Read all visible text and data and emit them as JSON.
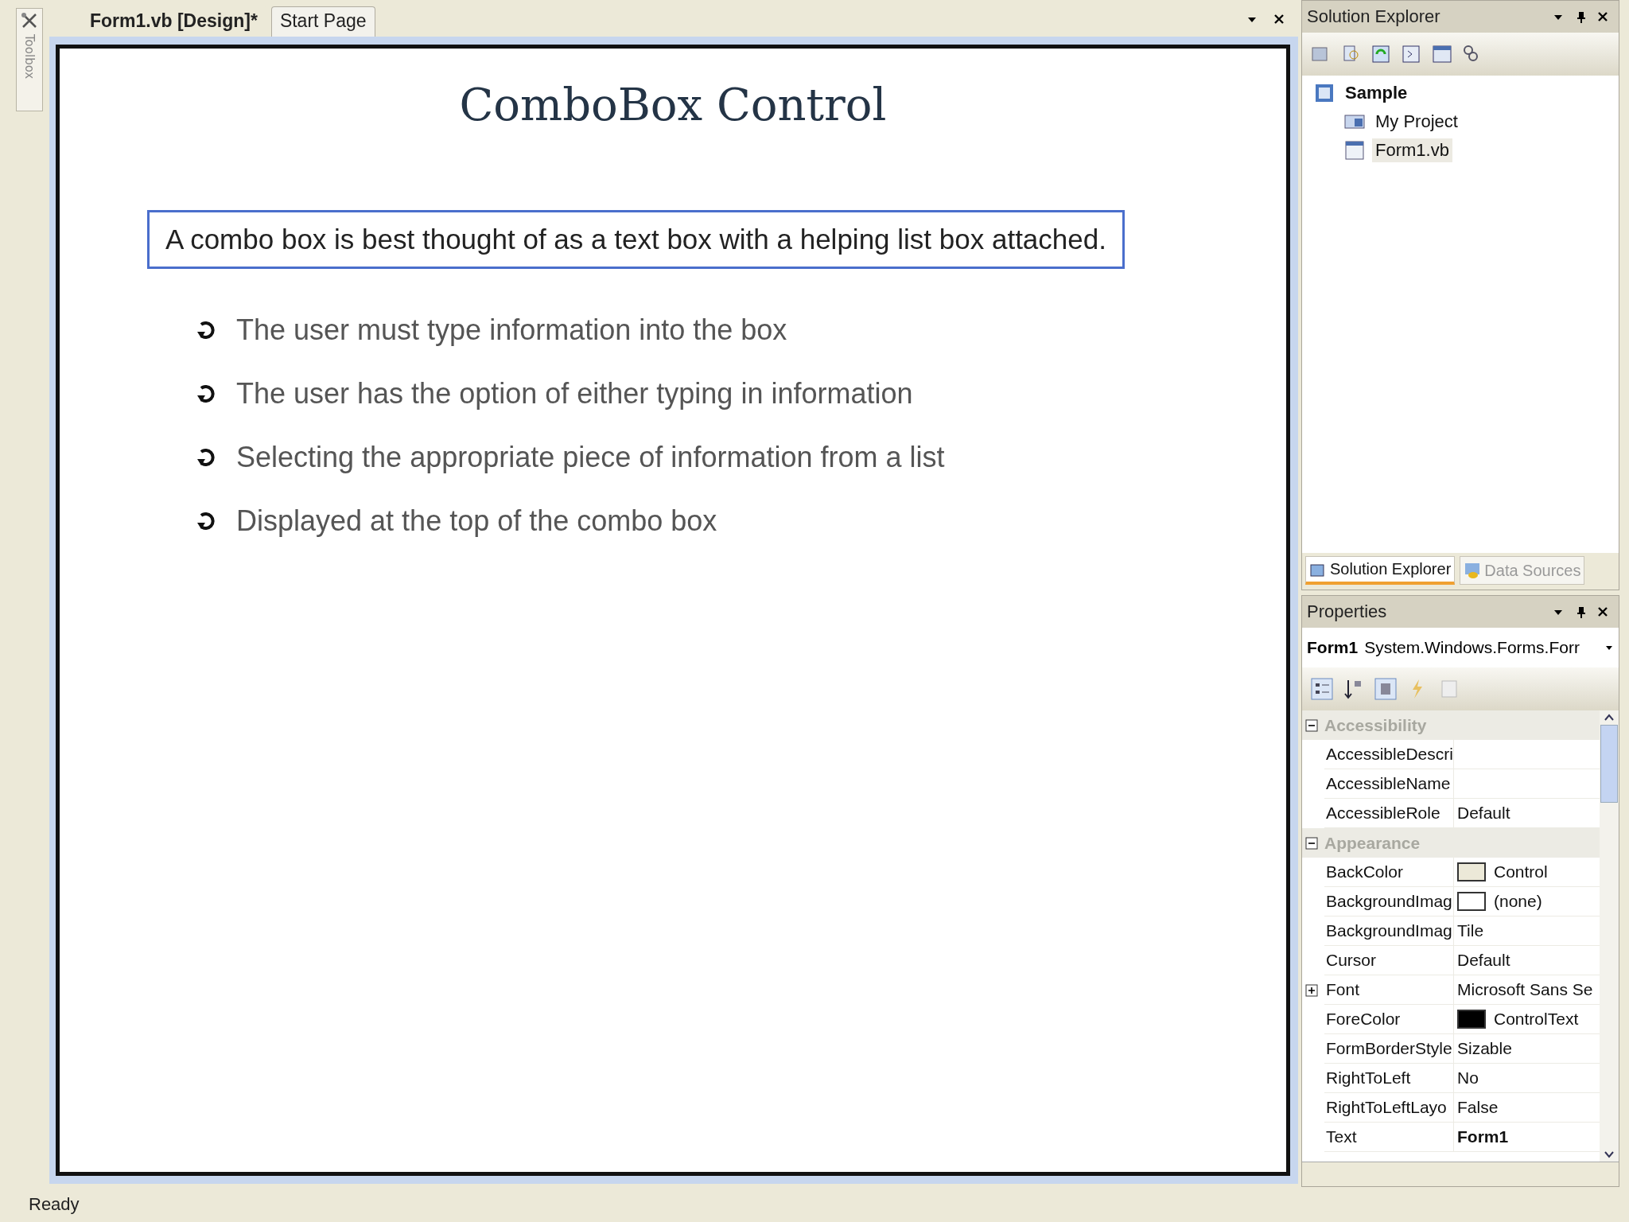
{
  "toolbox": {
    "label": "Toolbox"
  },
  "document_tabs": [
    {
      "label": "Form1.vb [Design]*",
      "selected": true
    },
    {
      "label": "Start Page",
      "selected": false
    }
  ],
  "slide": {
    "title": "ComboBox Control",
    "callout": "A combo box is best thought of as a text box with a helping list box attached.",
    "bullets": [
      "The user must type information into the box",
      "The user has the option of either typing in information",
      "Selecting the appropriate piece of information from a list",
      "Displayed at the top of the combo box"
    ]
  },
  "solution_explorer": {
    "title": "Solution Explorer",
    "tree": [
      {
        "label": "Sample",
        "kind": "solution",
        "selected": false,
        "children": [
          {
            "label": "My Project",
            "kind": "project",
            "selected": false
          },
          {
            "label": "Form1.vb",
            "kind": "form",
            "selected": true
          }
        ]
      }
    ],
    "tabs": [
      {
        "label": "Solution Explorer",
        "selected": true
      },
      {
        "label": "Data Sources",
        "selected": false
      }
    ]
  },
  "properties": {
    "title": "Properties",
    "object": "Form1",
    "object_type": "System.Windows.Forms.Forr",
    "categories": [
      {
        "name": "Accessibility",
        "expanded": true,
        "rows": [
          {
            "name": "AccessibleDescri",
            "value": ""
          },
          {
            "name": "AccessibleName",
            "value": ""
          },
          {
            "name": "AccessibleRole",
            "value": "Default"
          }
        ]
      },
      {
        "name": "Appearance",
        "expanded": true,
        "rows": [
          {
            "name": "BackColor",
            "value": "Control",
            "color": "#ece9d8"
          },
          {
            "name": "BackgroundImag",
            "value": "(none)",
            "color": "#ffffff"
          },
          {
            "name": "BackgroundImag",
            "value": "Tile"
          },
          {
            "name": "Cursor",
            "value": "Default"
          },
          {
            "name": "Font",
            "value": "Microsoft Sans Se",
            "expandable": true
          },
          {
            "name": "ForeColor",
            "value": "ControlText",
            "color": "#000000"
          },
          {
            "name": "FormBorderStyle",
            "value": "Sizable"
          },
          {
            "name": "RightToLeft",
            "value": "No"
          },
          {
            "name": "RightToLeftLayo",
            "value": "False"
          },
          {
            "name": "Text",
            "value": "Form1",
            "modified": true
          }
        ]
      }
    ]
  },
  "status_bar": {
    "text": "Ready"
  }
}
